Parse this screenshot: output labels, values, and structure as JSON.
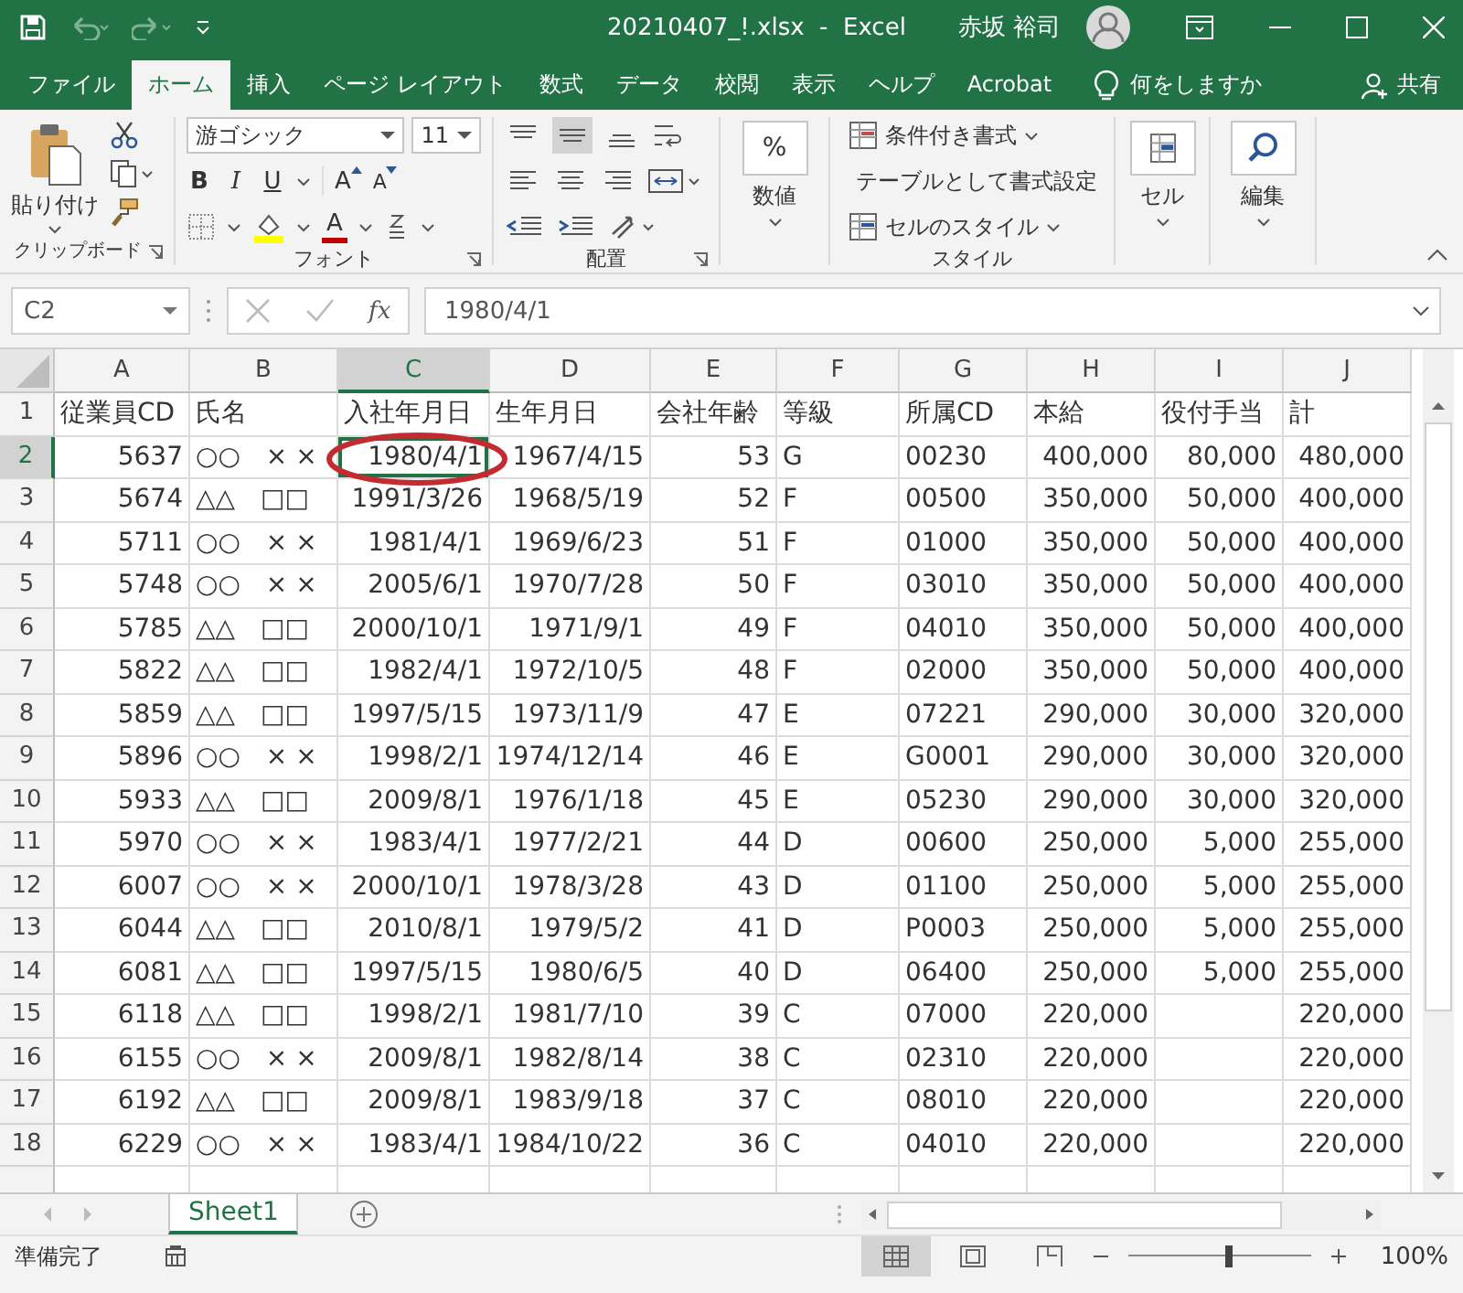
{
  "window": {
    "title": "20210407_!.xlsx  -  Excel",
    "user": "赤坂 裕司"
  },
  "ribbon_tabs": [
    {
      "label": "ファイル",
      "selected": false
    },
    {
      "label": "ホーム",
      "selected": true
    },
    {
      "label": "挿入",
      "selected": false
    },
    {
      "label": "ページ レイアウト",
      "selected": false
    },
    {
      "label": "数式",
      "selected": false
    },
    {
      "label": "データ",
      "selected": false
    },
    {
      "label": "校閲",
      "selected": false
    },
    {
      "label": "表示",
      "selected": false
    },
    {
      "label": "ヘルプ",
      "selected": false
    },
    {
      "label": "Acrobat",
      "selected": false
    }
  ],
  "tell_me": "何をしますか",
  "share": "共有",
  "ribbon": {
    "clipboard": {
      "paste": "貼り付け",
      "group": "クリップボード"
    },
    "font": {
      "name": "游ゴシック",
      "size": "11",
      "bold": "B",
      "italic": "I",
      "underline": "U",
      "grow": "A",
      "shrink": "A",
      "color_button": "A",
      "group": "フォント"
    },
    "alignment": {
      "group": "配置"
    },
    "number": {
      "symbol": "%",
      "label": "数値"
    },
    "styles": {
      "items": [
        "条件付き書式",
        "テーブルとして書式設定",
        "セルのスタイル"
      ],
      "group": "スタイル"
    },
    "cells": "セル",
    "editing": "編集"
  },
  "formula_bar": {
    "name_box": "C2",
    "fx": "fx",
    "value": "1980/4/1"
  },
  "sheet": {
    "columns": [
      {
        "label": "A",
        "numeric": true,
        "selected": false
      },
      {
        "label": "B",
        "numeric": false,
        "selected": false
      },
      {
        "label": "C",
        "numeric": true,
        "selected": true
      },
      {
        "label": "D",
        "numeric": true,
        "selected": false
      },
      {
        "label": "E",
        "numeric": true,
        "selected": false
      },
      {
        "label": "F",
        "numeric": false,
        "selected": false
      },
      {
        "label": "G",
        "numeric": false,
        "selected": false
      },
      {
        "label": "H",
        "numeric": true,
        "selected": false
      },
      {
        "label": "I",
        "numeric": true,
        "selected": false
      },
      {
        "label": "J",
        "numeric": true,
        "selected": false
      }
    ],
    "rows": [
      {
        "number": "1",
        "kind": "header",
        "selected": false,
        "cells": [
          "従業員CD",
          "氏名",
          "入社年月日",
          "生年月日",
          "会社年齢",
          "等級",
          "所属CD",
          "本給",
          "役付手当",
          "計"
        ]
      },
      {
        "number": "2",
        "kind": "data",
        "selected": true,
        "cells": [
          "5637",
          "○○　× ×",
          "1980/4/1",
          "1967/4/15",
          "53",
          "G",
          "00230",
          "400,000",
          "80,000",
          "480,000"
        ]
      },
      {
        "number": "3",
        "kind": "data",
        "selected": false,
        "cells": [
          "5674",
          "△△　□□",
          "1991/3/26",
          "1968/5/19",
          "52",
          "F",
          "00500",
          "350,000",
          "50,000",
          "400,000"
        ]
      },
      {
        "number": "4",
        "kind": "data",
        "selected": false,
        "cells": [
          "5711",
          "○○　× ×",
          "1981/4/1",
          "1969/6/23",
          "51",
          "F",
          "01000",
          "350,000",
          "50,000",
          "400,000"
        ]
      },
      {
        "number": "5",
        "kind": "data",
        "selected": false,
        "cells": [
          "5748",
          "○○　× ×",
          "2005/6/1",
          "1970/7/28",
          "50",
          "F",
          "03010",
          "350,000",
          "50,000",
          "400,000"
        ]
      },
      {
        "number": "6",
        "kind": "data",
        "selected": false,
        "cells": [
          "5785",
          "△△　□□",
          "2000/10/1",
          "1971/9/1",
          "49",
          "F",
          "04010",
          "350,000",
          "50,000",
          "400,000"
        ]
      },
      {
        "number": "7",
        "kind": "data",
        "selected": false,
        "cells": [
          "5822",
          "△△　□□",
          "1982/4/1",
          "1972/10/5",
          "48",
          "F",
          "02000",
          "350,000",
          "50,000",
          "400,000"
        ]
      },
      {
        "number": "8",
        "kind": "data",
        "selected": false,
        "cells": [
          "5859",
          "△△　□□",
          "1997/5/15",
          "1973/11/9",
          "47",
          "E",
          "07221",
          "290,000",
          "30,000",
          "320,000"
        ]
      },
      {
        "number": "9",
        "kind": "data",
        "selected": false,
        "cells": [
          "5896",
          "○○　× ×",
          "1998/2/1",
          "1974/12/14",
          "46",
          "E",
          "G0001",
          "290,000",
          "30,000",
          "320,000"
        ]
      },
      {
        "number": "10",
        "kind": "data",
        "selected": false,
        "cells": [
          "5933",
          "△△　□□",
          "2009/8/1",
          "1976/1/18",
          "45",
          "E",
          "05230",
          "290,000",
          "30,000",
          "320,000"
        ]
      },
      {
        "number": "11",
        "kind": "data",
        "selected": false,
        "cells": [
          "5970",
          "○○　× ×",
          "1983/4/1",
          "1977/2/21",
          "44",
          "D",
          "00600",
          "250,000",
          "5,000",
          "255,000"
        ]
      },
      {
        "number": "12",
        "kind": "data",
        "selected": false,
        "cells": [
          "6007",
          "○○　× ×",
          "2000/10/1",
          "1978/3/28",
          "43",
          "D",
          "01100",
          "250,000",
          "5,000",
          "255,000"
        ]
      },
      {
        "number": "13",
        "kind": "data",
        "selected": false,
        "cells": [
          "6044",
          "△△　□□",
          "2010/8/1",
          "1979/5/2",
          "41",
          "D",
          "P0003",
          "250,000",
          "5,000",
          "255,000"
        ]
      },
      {
        "number": "14",
        "kind": "data",
        "selected": false,
        "cells": [
          "6081",
          "△△　□□",
          "1997/5/15",
          "1980/6/5",
          "40",
          "D",
          "06400",
          "250,000",
          "5,000",
          "255,000"
        ]
      },
      {
        "number": "15",
        "kind": "data",
        "selected": false,
        "cells": [
          "6118",
          "△△　□□",
          "1998/2/1",
          "1981/7/10",
          "39",
          "C",
          "07000",
          "220,000",
          null,
          "220,000"
        ]
      },
      {
        "number": "16",
        "kind": "data",
        "selected": false,
        "cells": [
          "6155",
          "○○　× ×",
          "2009/8/1",
          "1982/8/14",
          "38",
          "C",
          "02310",
          "220,000",
          null,
          "220,000"
        ]
      },
      {
        "number": "17",
        "kind": "data",
        "selected": false,
        "cells": [
          "6192",
          "△△　□□",
          "2009/8/1",
          "1983/9/18",
          "37",
          "C",
          "08010",
          "220,000",
          null,
          "220,000"
        ]
      },
      {
        "number": "18",
        "kind": "data",
        "selected": false,
        "cells": [
          "6229",
          "○○　× ×",
          "1983/4/1",
          "1984/10/22",
          "36",
          "C",
          "04010",
          "220,000",
          null,
          "220,000"
        ]
      }
    ]
  },
  "sheet_tabs": [
    {
      "label": "Sheet1",
      "selected": true
    }
  ],
  "status_bar": {
    "text": "準備完了",
    "views": [
      {
        "kind": "normal",
        "selected": true
      },
      {
        "kind": "page_layout",
        "selected": false
      },
      {
        "kind": "page_break",
        "selected": false
      }
    ],
    "zoom": {
      "level": 0.55,
      "reading": "100%"
    }
  }
}
